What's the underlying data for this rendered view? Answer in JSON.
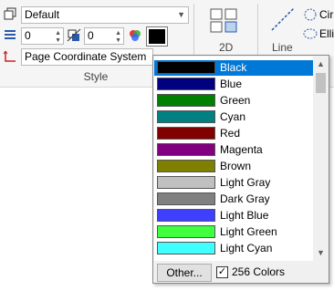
{
  "ribbon": {
    "layer_combo": "Default",
    "linewidth_value": "0",
    "linetype_value": "0",
    "current_color": "#000000",
    "coord_system": "Page Coordinate System",
    "group_label": "Style",
    "view_2d_label": "2D",
    "line_label": "Line",
    "circle_label": "Cir",
    "ellipse_label": "Elli"
  },
  "color_list": {
    "items": [
      {
        "name": "Black",
        "color": "#000000"
      },
      {
        "name": "Blue",
        "color": "#000080"
      },
      {
        "name": "Green",
        "color": "#008000"
      },
      {
        "name": "Cyan",
        "color": "#008080"
      },
      {
        "name": "Red",
        "color": "#800000"
      },
      {
        "name": "Magenta",
        "color": "#800080"
      },
      {
        "name": "Brown",
        "color": "#808000"
      },
      {
        "name": "Light Gray",
        "color": "#c0c0c0"
      },
      {
        "name": "Dark Gray",
        "color": "#808080"
      },
      {
        "name": "Light Blue",
        "color": "#3f3fff"
      },
      {
        "name": "Light Green",
        "color": "#3fff3f"
      },
      {
        "name": "Light Cyan",
        "color": "#3fffff"
      }
    ],
    "selected": "Black",
    "other_button": "Other...",
    "checkbox_label": "256 Colors",
    "checkbox_checked": true
  }
}
